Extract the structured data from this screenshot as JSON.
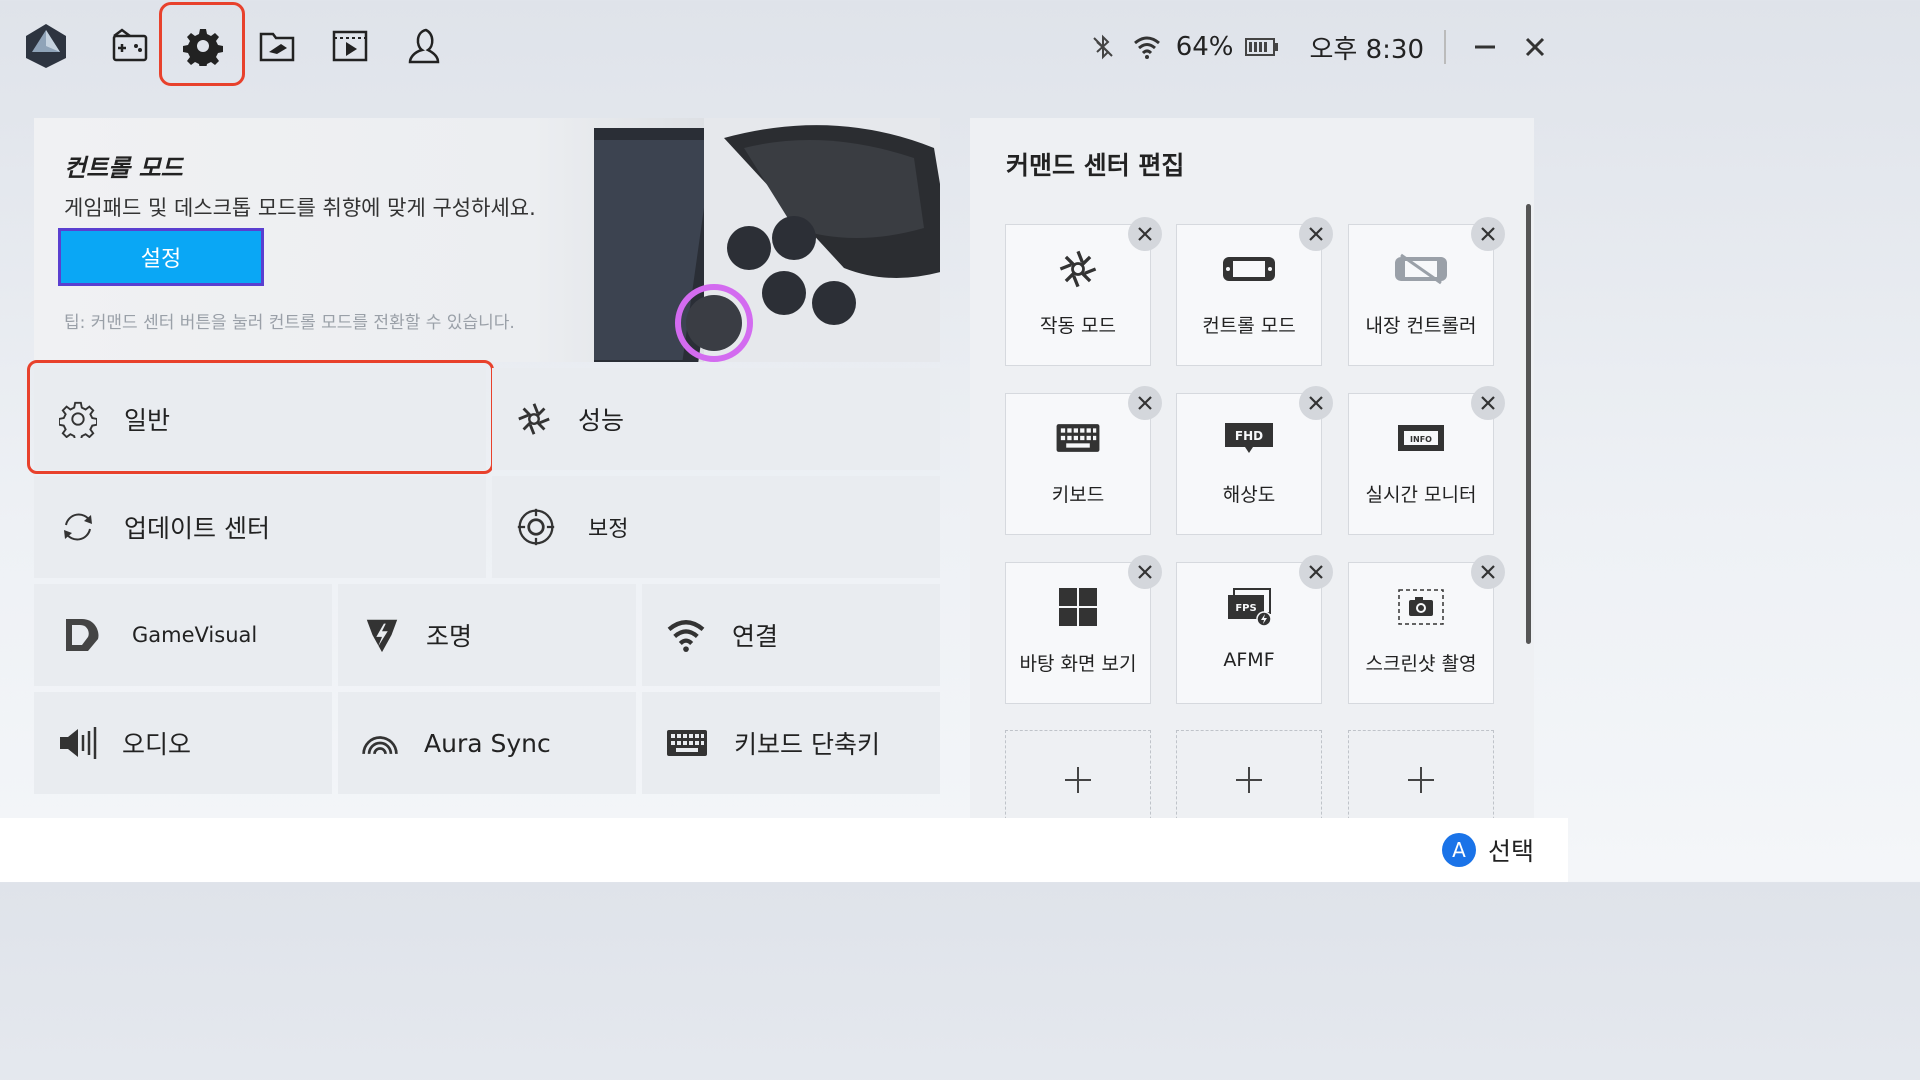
{
  "topbar": {
    "status": {
      "battery_percent": "64%",
      "clock": "오후 8:30"
    }
  },
  "banner": {
    "title": "컨트롤 모드",
    "description": "게임패드 및 데스크톱 모드를 취향에 맞게 구성하세요.",
    "button_label": "설정",
    "tip": "팁: 커맨드 센터 버튼을 눌러 컨트롤 모드를 전환할 수 있습니다."
  },
  "menu": {
    "general": "일반",
    "performance": "성능",
    "update_center": "업데이트 센터",
    "calibration": "보정",
    "gamevisual": "GameVisual",
    "lighting": "조명",
    "connection": "연결",
    "audio": "오디오",
    "aura_sync": "Aura Sync",
    "keyboard_shortcut": "키보드 단축키"
  },
  "command_center": {
    "title": "커맨드 센터 편집",
    "cards": [
      {
        "label": "작동 모드",
        "icon": "operating-mode-icon"
      },
      {
        "label": "컨트롤 모드",
        "icon": "gamepad-icon"
      },
      {
        "label": "내장 컨트롤러",
        "icon": "builtin-controller-off-icon"
      },
      {
        "label": "키보드",
        "icon": "keyboard-icon"
      },
      {
        "label": "해상도",
        "icon": "fhd-resolution-icon"
      },
      {
        "label": "실시간 모니터",
        "icon": "info-monitor-icon"
      },
      {
        "label": "바탕 화면 보기",
        "icon": "windows-desktop-icon"
      },
      {
        "label": "AFMF",
        "icon": "fps-icon"
      },
      {
        "label": "스크린샷 촬영",
        "icon": "screenshot-icon"
      }
    ]
  },
  "bottombar": {
    "button_glyph": "A",
    "hint_label": "선택"
  },
  "colors": {
    "accent_blue": "#0aa7f5",
    "highlight_red": "#e8412c",
    "button_border": "#5a3fd0"
  }
}
